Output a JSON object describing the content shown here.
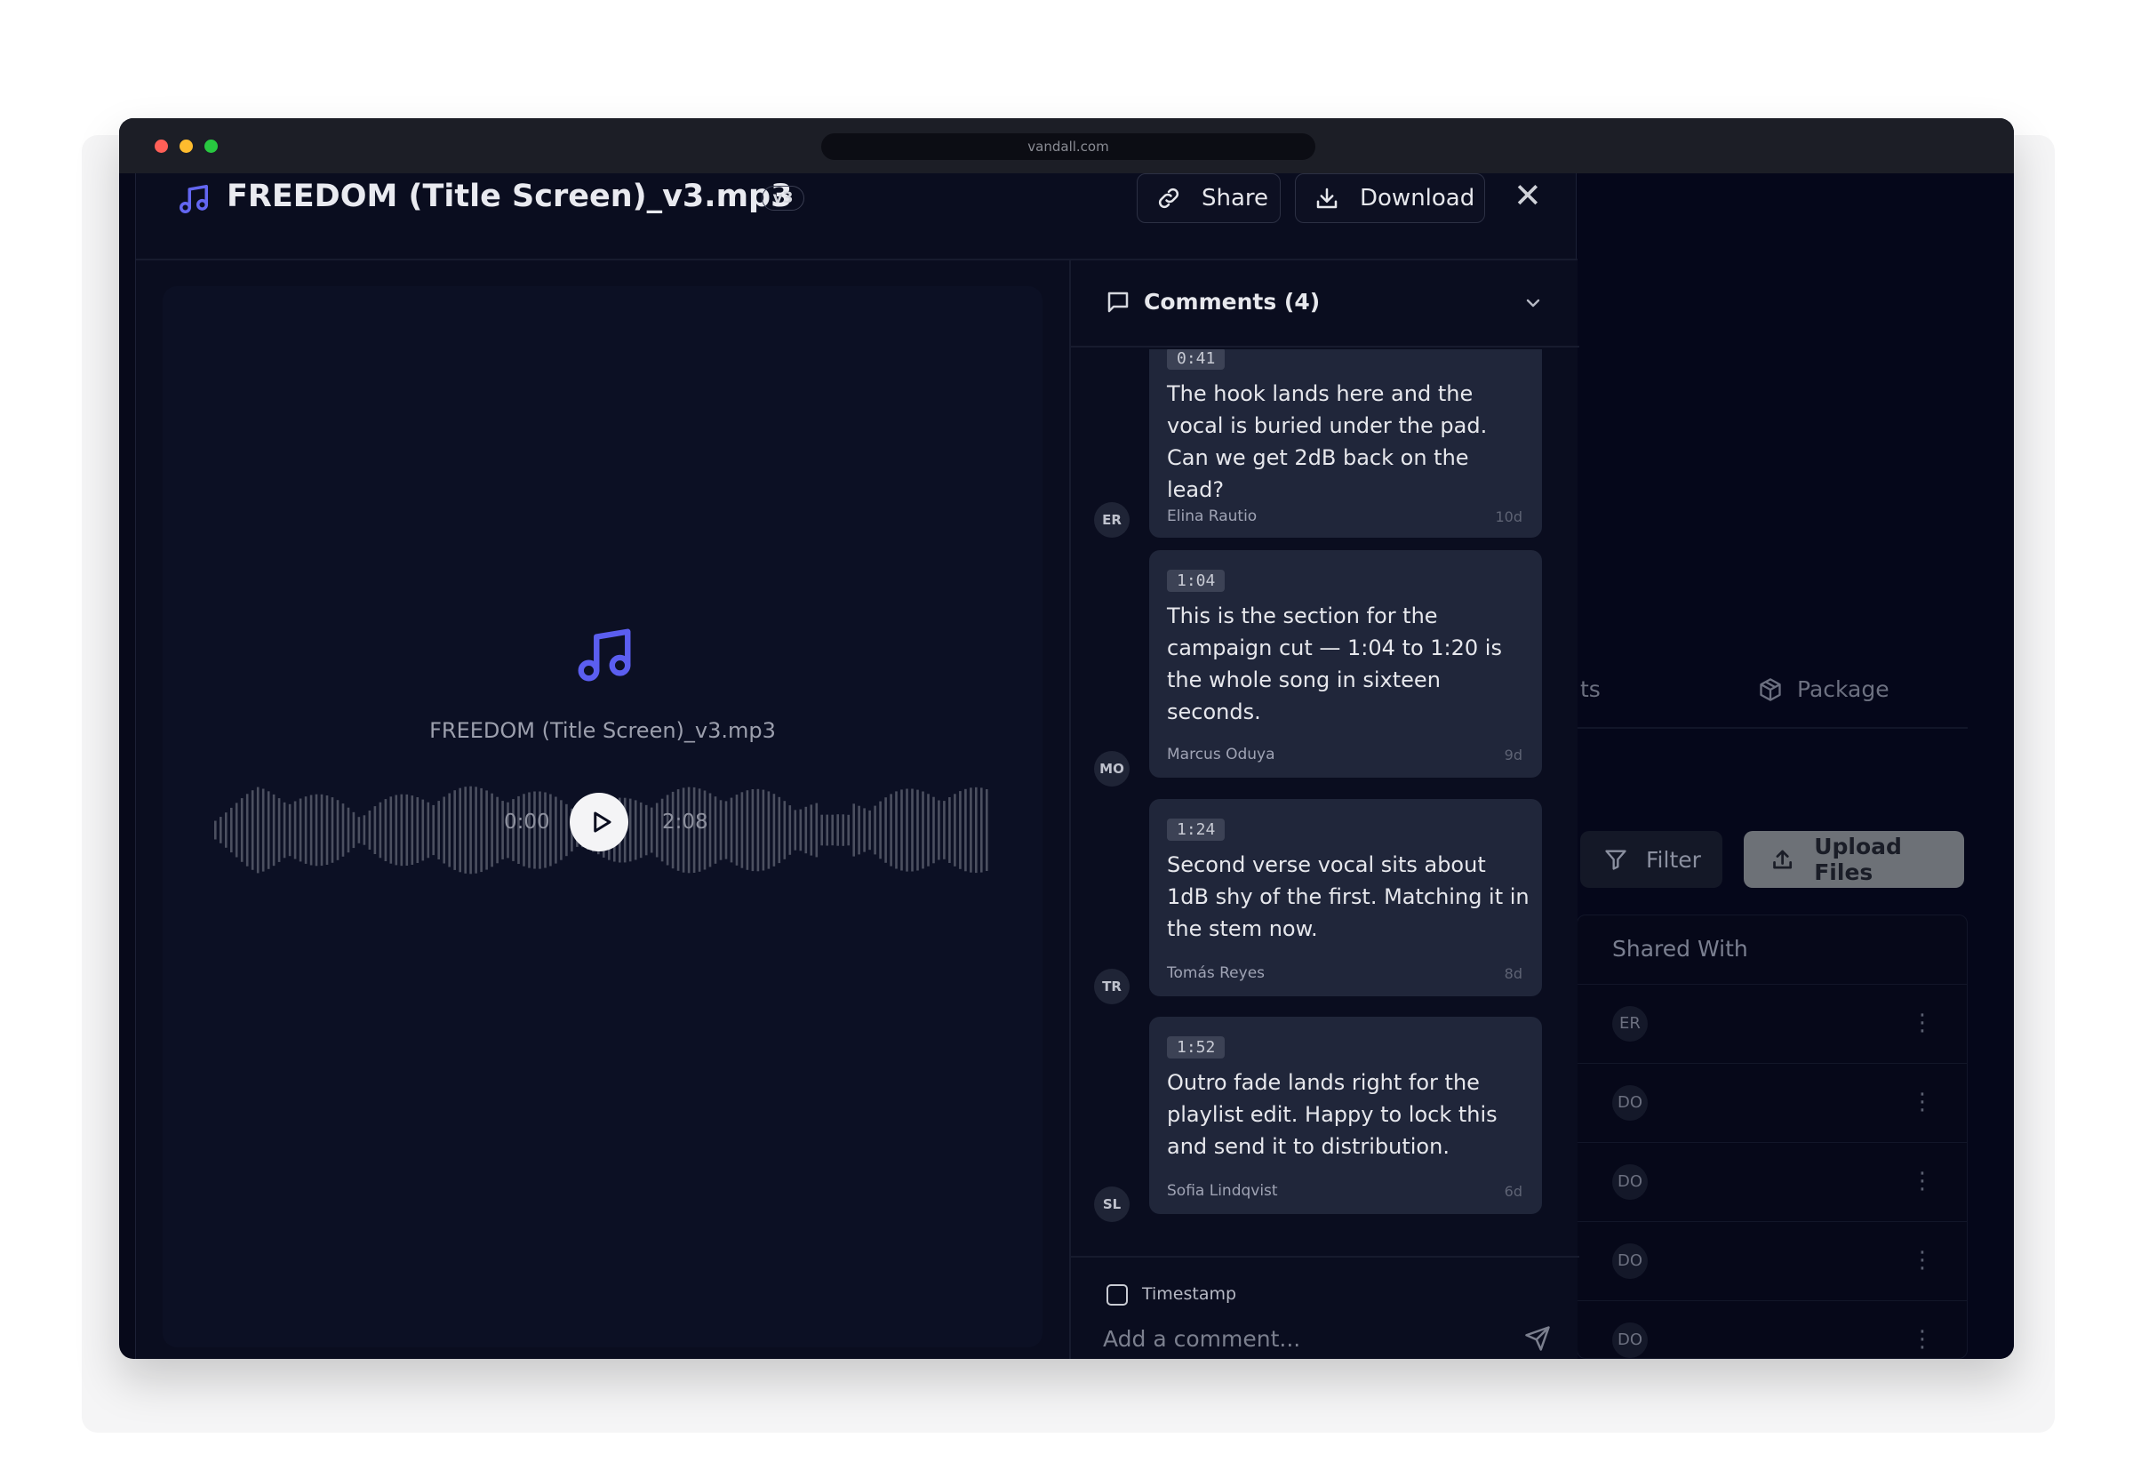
{
  "browser": {
    "url": "vandall.com"
  },
  "modal": {
    "file_name": "FREEDOM (Title Screen)_v3.mp3",
    "version": "v3",
    "share_label": "Share",
    "download_label": "Download"
  },
  "player": {
    "file_name": "FREEDOM (Title Screen)_v3.mp3",
    "current_time": "0:00",
    "duration": "2:08"
  },
  "comments": {
    "title": "Comments (4)",
    "items": [
      {
        "timestamp": "0:41",
        "text": "The hook lands here and the vocal is buried under the pad. Can we get 2dB back on the lead?",
        "author": "Elina Rautio",
        "initials": "ER",
        "age": "10d"
      },
      {
        "timestamp": "1:04",
        "text": "This is the section for the campaign cut — 1:04 to 1:20 is the whole song in sixteen seconds.",
        "author": "Marcus Oduya",
        "initials": "MO",
        "age": "9d"
      },
      {
        "timestamp": "1:24",
        "text": "Second verse vocal sits about 1dB shy of the first. Matching it in the stem now.",
        "author": "Tomás Reyes",
        "initials": "TR",
        "age": "8d"
      },
      {
        "timestamp": "1:52",
        "text": "Outro fade lands right for the playlist edit. Happy to lock this and send it to distribution.",
        "author": "Sofia Lindqvist",
        "initials": "SL",
        "age": "6d"
      }
    ],
    "timestamp_label": "Timestamp",
    "input_placeholder": "Add a comment..."
  },
  "background": {
    "tab_partial": "ts",
    "tab_package": "Package",
    "filter_label": "Filter",
    "upload_label": "Upload Files",
    "shared_with_header": "Shared With",
    "rows": [
      "ER",
      "DO",
      "DO",
      "DO",
      "DO"
    ]
  },
  "colors": {
    "accent": "#5b5ef0",
    "window_bg": "#07091a",
    "card_bg": "#20263a"
  }
}
